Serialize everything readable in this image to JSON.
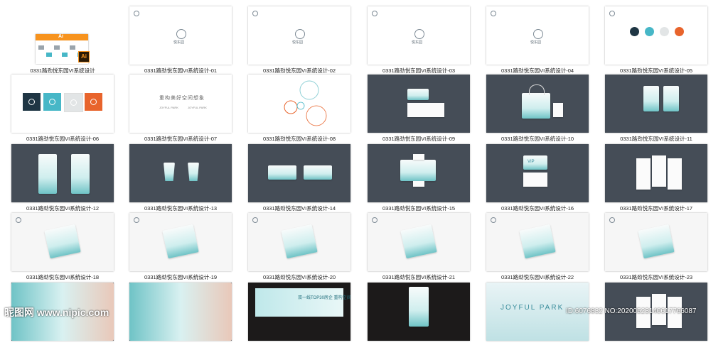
{
  "tiles": [
    {
      "caption": "0331路劲悦东园VI系统设计",
      "bg": "white",
      "kind": "ai"
    },
    {
      "caption": "0331路劲悦东园VI系统设计-01",
      "bg": "white",
      "kind": "logo"
    },
    {
      "caption": "0331路劲悦东园VI系统设计-02",
      "bg": "white",
      "kind": "logo"
    },
    {
      "caption": "0331路劲悦东园VI系统设计-03",
      "bg": "white",
      "kind": "logo"
    },
    {
      "caption": "0331路劲悦东园VI系统设计-04",
      "bg": "white",
      "kind": "logo"
    },
    {
      "caption": "0331路劲悦东园VI系统设计-05",
      "bg": "white",
      "kind": "swatches"
    },
    {
      "caption": "0331路劲悦东园VI系统设计-06",
      "bg": "white",
      "kind": "squares"
    },
    {
      "caption": "0331路劲悦东园VI系统设计-07",
      "bg": "white",
      "kind": "text"
    },
    {
      "caption": "0331路劲悦东园VI系统设计-08",
      "bg": "white",
      "kind": "circles"
    },
    {
      "caption": "0331路劲悦东园VI系统设计-09",
      "bg": "dark",
      "kind": "cards2"
    },
    {
      "caption": "0331路劲悦东园VI系统设计-10",
      "bg": "dark",
      "kind": "bag"
    },
    {
      "caption": "0331路劲悦东园VI系统设计-11",
      "bg": "dark",
      "kind": "envelopes"
    },
    {
      "caption": "0331路劲悦东园VI系统设计-12",
      "bg": "dark",
      "kind": "panels"
    },
    {
      "caption": "0331路劲悦东园VI系统设计-13",
      "bg": "dark",
      "kind": "cups"
    },
    {
      "caption": "0331路劲悦东园VI系统设计-14",
      "bg": "dark",
      "kind": "wide2"
    },
    {
      "caption": "0331路劲悦东园VI系统设计-15",
      "bg": "dark",
      "kind": "box"
    },
    {
      "caption": "0331路劲悦东园VI系统设计-16",
      "bg": "dark",
      "kind": "vip"
    },
    {
      "caption": "0331路劲悦东园VI系统设计-17",
      "bg": "dark",
      "kind": "docs"
    },
    {
      "caption": "0331路劲悦东园VI系统设计-18",
      "bg": "light",
      "kind": "mock"
    },
    {
      "caption": "0331路劲悦东园VI系统设计-19",
      "bg": "light",
      "kind": "mock"
    },
    {
      "caption": "0331路劲悦东园VI系统设计-20",
      "bg": "light",
      "kind": "mock"
    },
    {
      "caption": "0331路劲悦东园VI系统设计-21",
      "bg": "light",
      "kind": "mock"
    },
    {
      "caption": "0331路劲悦东园VI系统设计-22",
      "bg": "light",
      "kind": "mock"
    },
    {
      "caption": "0331路劲悦东园VI系统设计-23",
      "bg": "light",
      "kind": "mock"
    },
    {
      "caption": "",
      "bg": "dark",
      "kind": "poster"
    },
    {
      "caption": "",
      "bg": "dark",
      "kind": "poster"
    },
    {
      "caption": "",
      "bg": "photo",
      "kind": "billboard"
    },
    {
      "caption": "",
      "bg": "photo",
      "kind": "lightbox"
    },
    {
      "caption": "",
      "bg": "sky",
      "kind": "joyful"
    },
    {
      "caption": "",
      "bg": "dark",
      "kind": "docs"
    }
  ],
  "text": {
    "logo_label": "悦东园",
    "tagline": "重构美好空间想象",
    "joyful": "JOYFUL PARK",
    "joyful_sub": "JOYFUL PARK",
    "vip": "VIP",
    "billboard": "双一线TOP30房企 重构空间想象",
    "ai_label": "Ai"
  },
  "swatches": [
    "#1f3644",
    "#47b7c7",
    "#e2e5e6",
    "#e8642c"
  ],
  "watermark": {
    "left": "昵图网 www.nipic.com",
    "right": "ID:6076832 NO:20200523140617766087"
  }
}
